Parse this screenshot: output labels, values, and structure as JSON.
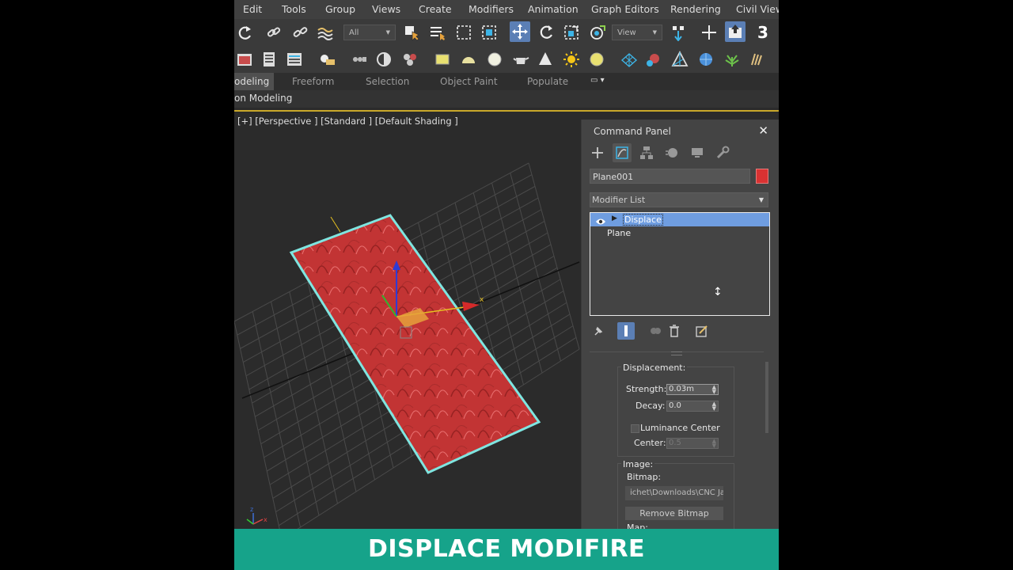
{
  "menubar": {
    "items": [
      "Edit",
      "Tools",
      "Group",
      "Views",
      "Create",
      "Modifiers",
      "Animation",
      "Graph Editors",
      "Rendering",
      "Civil View"
    ]
  },
  "toolbar": {
    "selection_filter": "All",
    "ref_coord": "View",
    "snap_label": "3"
  },
  "ribbon": {
    "tabs": [
      "odeling",
      "Freeform",
      "Selection",
      "Object Paint",
      "Populate"
    ],
    "sub_label": "on Modeling"
  },
  "viewport": {
    "label": "[+] [Perspective ] [Standard ] [Default Shading ]",
    "axis_x": "x",
    "axis_y": "y",
    "axis_z": "z"
  },
  "command_panel": {
    "title": "Command Panel",
    "close": "✕",
    "object_name": "Plane001",
    "object_color": "#d93232",
    "modifier_list": "Modifier List",
    "stack": {
      "modifier": "Displace",
      "base": "Plane"
    },
    "displacement": {
      "group": "Displacement:",
      "strength_label": "Strength:",
      "strength": "0.03m",
      "decay_label": "Decay:",
      "decay": "0.0",
      "luminance_center": "Luminance Center",
      "center_label": "Center:",
      "center": "0.5"
    },
    "image": {
      "group": "Image:",
      "bitmap_label": "Bitmap:",
      "bitmap_path": "ichet\\Downloads\\CNC Ja",
      "remove_bitmap": "Remove Bitmap",
      "map_label": "Map:"
    }
  },
  "banner": {
    "text": "DISPLACE MODIFIRE",
    "color": "#16a38a"
  }
}
